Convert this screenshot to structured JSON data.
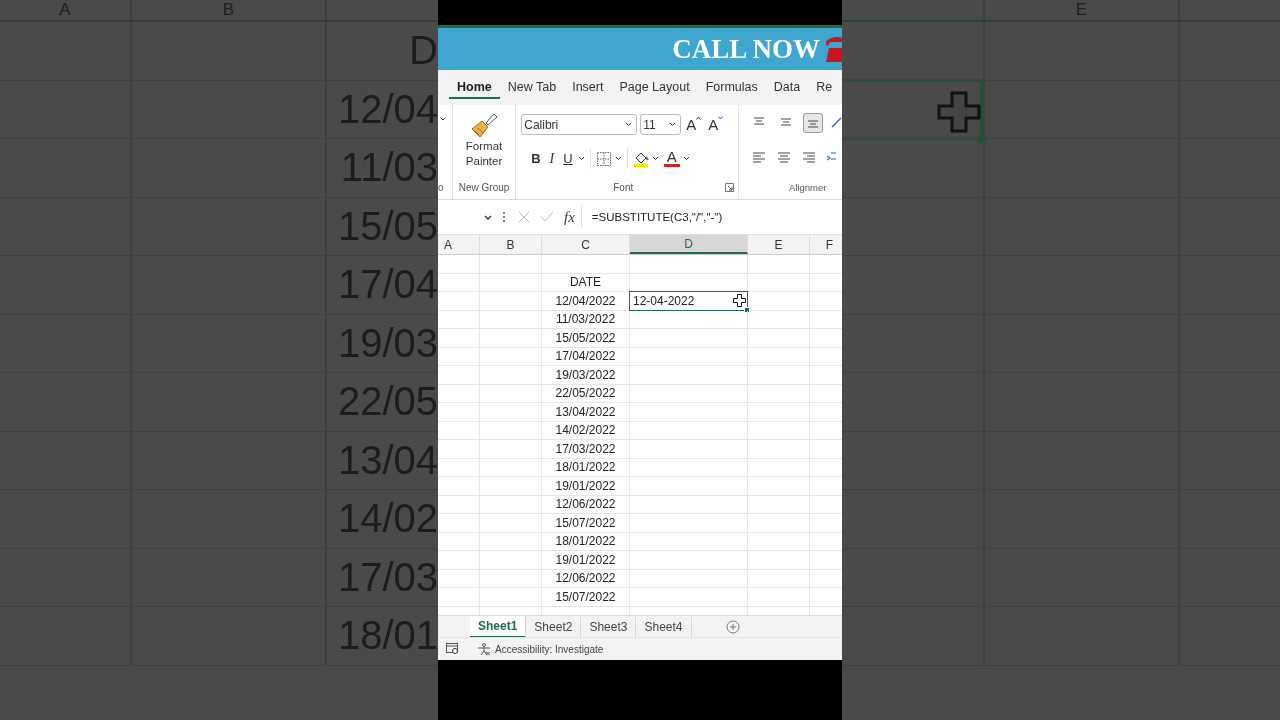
{
  "backdrop": {
    "left_headers": [
      "A",
      "B"
    ],
    "left_cells": [
      "D",
      "12/04",
      "11/03",
      "15/05",
      "17/04",
      "19/03",
      "22/05",
      "13/04",
      "14/02",
      "17/03",
      "18/01"
    ],
    "right_headers": [
      "E"
    ]
  },
  "banner": {
    "text": "CALL NOW"
  },
  "tabs": [
    {
      "label": "Home",
      "selected": true
    },
    {
      "label": "New Tab",
      "selected": false
    },
    {
      "label": "Insert",
      "selected": false
    },
    {
      "label": "Page Layout",
      "selected": false
    },
    {
      "label": "Formulas",
      "selected": false
    },
    {
      "label": "Data",
      "selected": false
    },
    {
      "label": "Re",
      "selected": false
    }
  ],
  "ribbon": {
    "clipped_group_label": "o",
    "painter_label": "Format Painter",
    "painter_group": "New Group",
    "font_group": "Font",
    "font_name": "Calibri",
    "font_size": "11",
    "grow": "A",
    "shrink": "A",
    "bold": "B",
    "italic": "I",
    "underline": "U",
    "font_color_letter": "A",
    "alignment_group": "Alignmer",
    "align_buttons": [
      {
        "kind": "top",
        "selected": false
      },
      {
        "kind": "middle",
        "selected": false
      },
      {
        "kind": "bottom",
        "selected": true
      }
    ]
  },
  "formula_bar": {
    "fx": "fx",
    "formula": "=SUBSTITUTE(C3,\"/\",\"-\")"
  },
  "columns": [
    {
      "label": "A",
      "selected": false
    },
    {
      "label": "B",
      "selected": false
    },
    {
      "label": "C",
      "selected": false
    },
    {
      "label": "D",
      "selected": true
    },
    {
      "label": "E",
      "selected": false
    },
    {
      "label": "F",
      "selected": false
    }
  ],
  "date_header": "DATE",
  "rows": [
    {
      "date": "12/04/2022",
      "result": "12-04-2022",
      "selected": true
    },
    {
      "date": "11/03/2022"
    },
    {
      "date": "15/05/2022"
    },
    {
      "date": "17/04/2022"
    },
    {
      "date": "19/03/2022"
    },
    {
      "date": "22/05/2022"
    },
    {
      "date": "13/04/2022"
    },
    {
      "date": "14/02/2022"
    },
    {
      "date": "17/03/2022"
    },
    {
      "date": "18/01/2022"
    },
    {
      "date": "19/01/2022"
    },
    {
      "date": "12/06/2022"
    },
    {
      "date": "15/07/2022"
    },
    {
      "date": "18/01/2022"
    },
    {
      "date": "19/01/2022"
    },
    {
      "date": "12/06/2022"
    },
    {
      "date": "15/07/2022"
    }
  ],
  "sheets": [
    {
      "label": "Sheet1",
      "selected": true
    },
    {
      "label": "Sheet2",
      "selected": false
    },
    {
      "label": "Sheet3",
      "selected": false
    },
    {
      "label": "Sheet4",
      "selected": false
    }
  ],
  "status_bar": {
    "text": "Accessibility: Investigate"
  }
}
